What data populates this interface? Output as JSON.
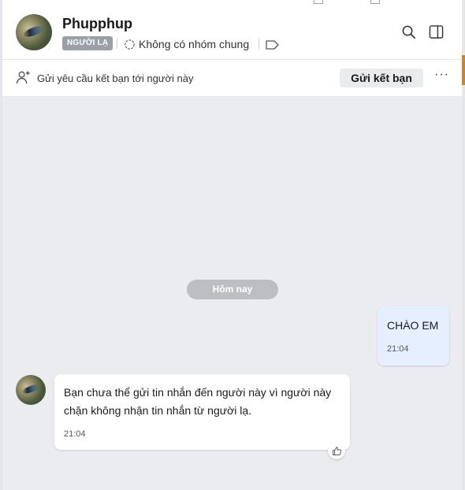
{
  "contact": {
    "name": "Phupphup",
    "badge": "NGƯỜI LẠ",
    "common_groups": "Không có nhóm chung"
  },
  "header_icons": [
    "search-icon",
    "sidebar-toggle-icon",
    "tag-icon",
    "group-icon"
  ],
  "friend_request": {
    "text": "Gửi yêu cầu kết bạn tới người này",
    "button_label": "Gửi kết bạn",
    "more_label": "···"
  },
  "chat": {
    "date_label": "Hôm nay",
    "messages": [
      {
        "direction": "sent",
        "text": "CHÀO EM",
        "time": "21:04"
      },
      {
        "direction": "received",
        "text": "Bạn chưa thể gửi tin nhắn đến người này vì người này chặn không nhận tin nhắn từ người lạ.",
        "time": "21:04"
      }
    ]
  },
  "colors": {
    "sent_bubble": "#e5efff",
    "chat_background": "#ebecf0",
    "badge_background": "#9aa0a6",
    "accent": "#c8862a"
  }
}
